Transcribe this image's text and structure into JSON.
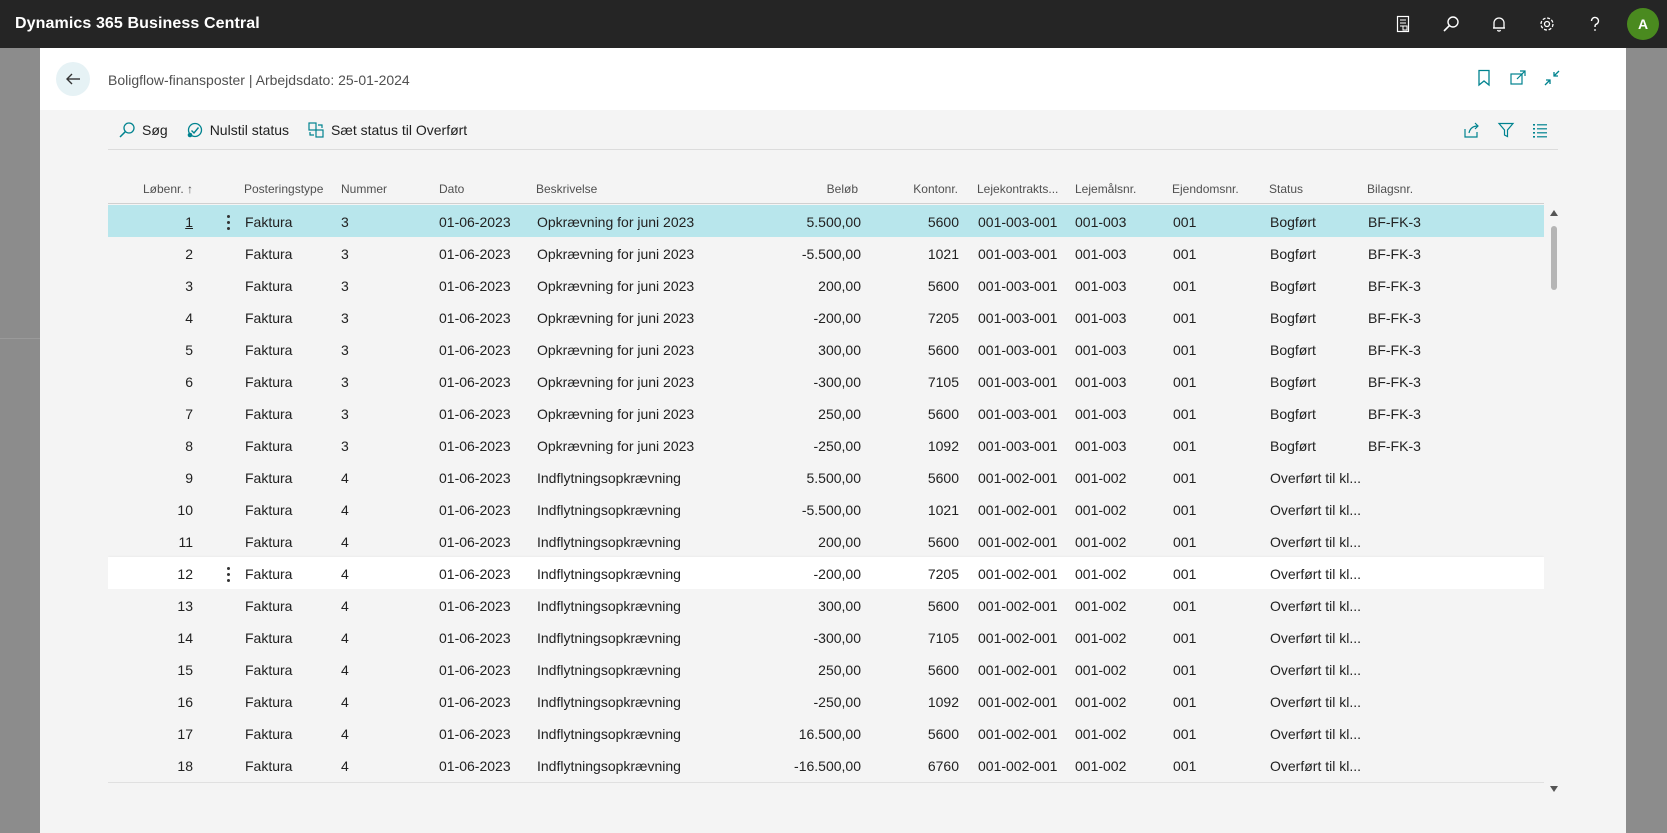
{
  "app": {
    "title": "Dynamics 365 Business Central",
    "user_initial": "A"
  },
  "page": {
    "title": "Boligflow-finansposter | Arbejdsdato: 25-01-2024"
  },
  "actions": {
    "search": "Søg",
    "reset_status": "Nulstil status",
    "set_status": "Sæt status til Overført"
  },
  "columns": {
    "lobenr": "Løbenr. ↑",
    "posteringstype": "Posteringstype",
    "nummer": "Nummer",
    "dato": "Dato",
    "beskrivelse": "Beskrivelse",
    "belob": "Beløb",
    "kontonr": "Kontonr.",
    "lejekontrakt": "Lejekontrakts...",
    "lejemaal": "Lejemålsnr.",
    "ejendom": "Ejendomsnr.",
    "status": "Status",
    "bilag": "Bilagsnr."
  },
  "rows": [
    {
      "lobenr": "1",
      "type": "Faktura",
      "nummer": "3",
      "dato": "01-06-2023",
      "beskrivelse": "Opkrævning for juni 2023",
      "belob": "5.500,00",
      "konto": "5600",
      "lejekontrakt": "001-003-001",
      "lejemaal": "001-003",
      "ejendom": "001",
      "status": "Bogført",
      "bilag": "BF-FK-3"
    },
    {
      "lobenr": "2",
      "type": "Faktura",
      "nummer": "3",
      "dato": "01-06-2023",
      "beskrivelse": "Opkrævning for juni 2023",
      "belob": "-5.500,00",
      "konto": "1021",
      "lejekontrakt": "001-003-001",
      "lejemaal": "001-003",
      "ejendom": "001",
      "status": "Bogført",
      "bilag": "BF-FK-3"
    },
    {
      "lobenr": "3",
      "type": "Faktura",
      "nummer": "3",
      "dato": "01-06-2023",
      "beskrivelse": "Opkrævning for juni 2023",
      "belob": "200,00",
      "konto": "5600",
      "lejekontrakt": "001-003-001",
      "lejemaal": "001-003",
      "ejendom": "001",
      "status": "Bogført",
      "bilag": "BF-FK-3"
    },
    {
      "lobenr": "4",
      "type": "Faktura",
      "nummer": "3",
      "dato": "01-06-2023",
      "beskrivelse": "Opkrævning for juni 2023",
      "belob": "-200,00",
      "konto": "7205",
      "lejekontrakt": "001-003-001",
      "lejemaal": "001-003",
      "ejendom": "001",
      "status": "Bogført",
      "bilag": "BF-FK-3"
    },
    {
      "lobenr": "5",
      "type": "Faktura",
      "nummer": "3",
      "dato": "01-06-2023",
      "beskrivelse": "Opkrævning for juni 2023",
      "belob": "300,00",
      "konto": "5600",
      "lejekontrakt": "001-003-001",
      "lejemaal": "001-003",
      "ejendom": "001",
      "status": "Bogført",
      "bilag": "BF-FK-3"
    },
    {
      "lobenr": "6",
      "type": "Faktura",
      "nummer": "3",
      "dato": "01-06-2023",
      "beskrivelse": "Opkrævning for juni 2023",
      "belob": "-300,00",
      "konto": "7105",
      "lejekontrakt": "001-003-001",
      "lejemaal": "001-003",
      "ejendom": "001",
      "status": "Bogført",
      "bilag": "BF-FK-3"
    },
    {
      "lobenr": "7",
      "type": "Faktura",
      "nummer": "3",
      "dato": "01-06-2023",
      "beskrivelse": "Opkrævning for juni 2023",
      "belob": "250,00",
      "konto": "5600",
      "lejekontrakt": "001-003-001",
      "lejemaal": "001-003",
      "ejendom": "001",
      "status": "Bogført",
      "bilag": "BF-FK-3"
    },
    {
      "lobenr": "8",
      "type": "Faktura",
      "nummer": "3",
      "dato": "01-06-2023",
      "beskrivelse": "Opkrævning for juni 2023",
      "belob": "-250,00",
      "konto": "1092",
      "lejekontrakt": "001-003-001",
      "lejemaal": "001-003",
      "ejendom": "001",
      "status": "Bogført",
      "bilag": "BF-FK-3"
    },
    {
      "lobenr": "9",
      "type": "Faktura",
      "nummer": "4",
      "dato": "01-06-2023",
      "beskrivelse": "Indflytningsopkrævning",
      "belob": "5.500,00",
      "konto": "5600",
      "lejekontrakt": "001-002-001",
      "lejemaal": "001-002",
      "ejendom": "001",
      "status": "Overført til kl...",
      "bilag": ""
    },
    {
      "lobenr": "10",
      "type": "Faktura",
      "nummer": "4",
      "dato": "01-06-2023",
      "beskrivelse": "Indflytningsopkrævning",
      "belob": "-5.500,00",
      "konto": "1021",
      "lejekontrakt": "001-002-001",
      "lejemaal": "001-002",
      "ejendom": "001",
      "status": "Overført til kl...",
      "bilag": ""
    },
    {
      "lobenr": "11",
      "type": "Faktura",
      "nummer": "4",
      "dato": "01-06-2023",
      "beskrivelse": "Indflytningsopkrævning",
      "belob": "200,00",
      "konto": "5600",
      "lejekontrakt": "001-002-001",
      "lejemaal": "001-002",
      "ejendom": "001",
      "status": "Overført til kl...",
      "bilag": ""
    },
    {
      "lobenr": "12",
      "type": "Faktura",
      "nummer": "4",
      "dato": "01-06-2023",
      "beskrivelse": "Indflytningsopkrævning",
      "belob": "-200,00",
      "konto": "7205",
      "lejekontrakt": "001-002-001",
      "lejemaal": "001-002",
      "ejendom": "001",
      "status": "Overført til kl...",
      "bilag": ""
    },
    {
      "lobenr": "13",
      "type": "Faktura",
      "nummer": "4",
      "dato": "01-06-2023",
      "beskrivelse": "Indflytningsopkrævning",
      "belob": "300,00",
      "konto": "5600",
      "lejekontrakt": "001-002-001",
      "lejemaal": "001-002",
      "ejendom": "001",
      "status": "Overført til kl...",
      "bilag": ""
    },
    {
      "lobenr": "14",
      "type": "Faktura",
      "nummer": "4",
      "dato": "01-06-2023",
      "beskrivelse": "Indflytningsopkrævning",
      "belob": "-300,00",
      "konto": "7105",
      "lejekontrakt": "001-002-001",
      "lejemaal": "001-002",
      "ejendom": "001",
      "status": "Overført til kl...",
      "bilag": ""
    },
    {
      "lobenr": "15",
      "type": "Faktura",
      "nummer": "4",
      "dato": "01-06-2023",
      "beskrivelse": "Indflytningsopkrævning",
      "belob": "250,00",
      "konto": "5600",
      "lejekontrakt": "001-002-001",
      "lejemaal": "001-002",
      "ejendom": "001",
      "status": "Overført til kl...",
      "bilag": ""
    },
    {
      "lobenr": "16",
      "type": "Faktura",
      "nummer": "4",
      "dato": "01-06-2023",
      "beskrivelse": "Indflytningsopkrævning",
      "belob": "-250,00",
      "konto": "1092",
      "lejekontrakt": "001-002-001",
      "lejemaal": "001-002",
      "ejendom": "001",
      "status": "Overført til kl...",
      "bilag": ""
    },
    {
      "lobenr": "17",
      "type": "Faktura",
      "nummer": "4",
      "dato": "01-06-2023",
      "beskrivelse": "Indflytningsopkrævning",
      "belob": "16.500,00",
      "konto": "5600",
      "lejekontrakt": "001-002-001",
      "lejemaal": "001-002",
      "ejendom": "001",
      "status": "Overført til kl...",
      "bilag": ""
    },
    {
      "lobenr": "18",
      "type": "Faktura",
      "nummer": "4",
      "dato": "01-06-2023",
      "beskrivelse": "Indflytningsopkrævning",
      "belob": "-16.500,00",
      "konto": "6760",
      "lejekontrakt": "001-002-001",
      "lejemaal": "001-002",
      "ejendom": "001",
      "status": "Overført til kl...",
      "bilag": ""
    }
  ],
  "selected_row": 0,
  "hover_row": 11,
  "colors": {
    "appbar": "#252525",
    "accent": "#00838f",
    "selected_row": "#b8e6ec",
    "avatar": "#4a8a1f"
  }
}
